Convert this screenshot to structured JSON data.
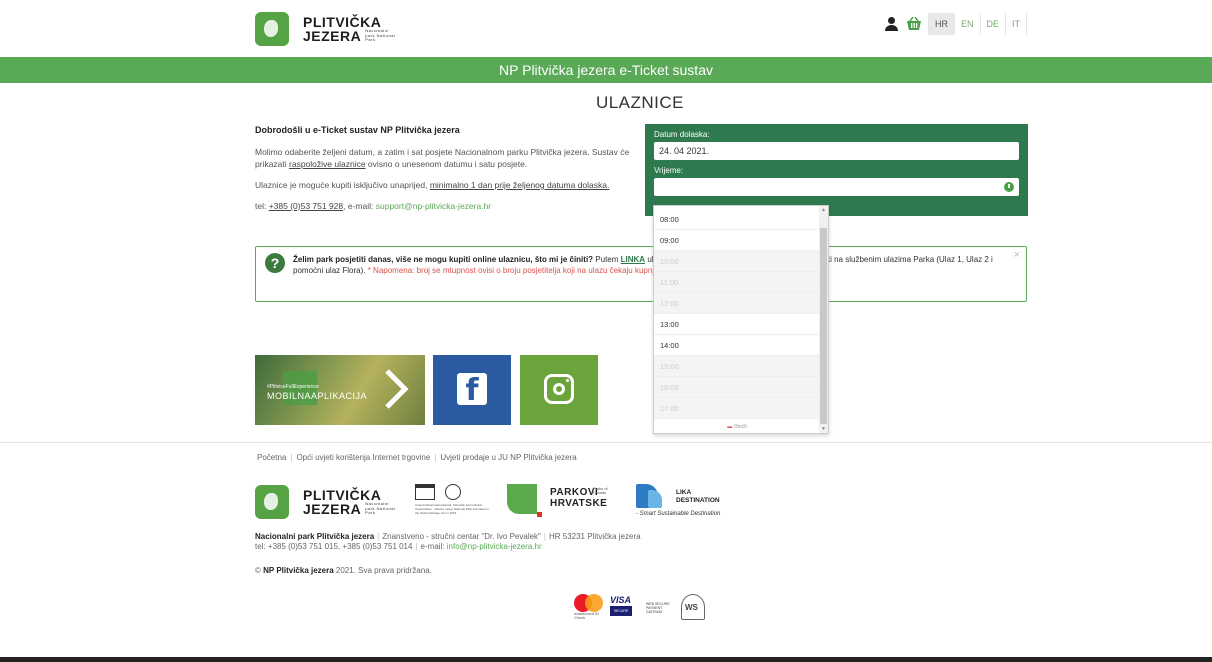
{
  "header": {
    "logo_line1": "PLITVIČKA",
    "logo_line2": "JEZERA",
    "logo_sub": "Nacionalni park National Park",
    "languages": [
      "HR",
      "EN",
      "DE",
      "IT"
    ],
    "active_language": "HR",
    "user_icon": "user-icon",
    "basket_icon": "basket-icon"
  },
  "banner": {
    "title": "NP Plitvička jezera e-Ticket sustav"
  },
  "page": {
    "title": "ULAZNICE"
  },
  "intro": {
    "heading": "Dobrodošli u e-Ticket sustav NP Plitvička jezera",
    "p1_a": "Molimo odaberite željeni datum, a zatim i sat posjete Nacionalnom parku Plitvička jezera. Sustav će prikazati ",
    "p1_link": "raspoložive ulaznice",
    "p1_b": " ovisno o unesenom datumu i satu posjete.",
    "p2_a": "Ulaznice je moguće kupiti isključivo unaprijed, ",
    "p2_u": "minimalno 1 dan prije željenog datuma dolaska.",
    "tel_label": "tel: ",
    "tel": "+385 (0)53 751 928",
    "email_label": ", e-mail: ",
    "email": "support@np-plitvicka-jezera.hr"
  },
  "booking": {
    "date_label": "Datum dolaska:",
    "date_value": "24. 04 2021.",
    "time_label": "Vrijeme:",
    "time_value": ""
  },
  "time_dropdown": {
    "options": [
      {
        "label": "08:00",
        "disabled": false
      },
      {
        "label": "09:00",
        "disabled": false
      },
      {
        "label": "10:00",
        "disabled": true
      },
      {
        "label": "11:00",
        "disabled": true
      },
      {
        "label": "12:00",
        "disabled": true
      },
      {
        "label": "13:00",
        "disabled": false
      },
      {
        "label": "14:00",
        "disabled": false
      },
      {
        "label": "15:00",
        "disabled": true
      },
      {
        "label": "16:00",
        "disabled": true
      },
      {
        "label": "17:00",
        "disabled": true
      }
    ],
    "clear_label": "Obriši"
  },
  "notice": {
    "question": "Želim park posjetiti danas, više ne mogu kupiti online ulaznicu, što mi je činiti?",
    "text_a": " Putem ",
    "link": "LINKA",
    "text_b": " ulaznica po satu i ulazu u park koje je moguće kupiti na službenim ulazima Parka (Ulaz 1, Ulaz 2 i pomoćni ulaz Flora). ",
    "red_a": "* Napomena: broj se m",
    "red_b": "tupnost ovisi o broju posjetitelja koji na ulazu čekaju kupnju na licu mjesta.",
    "close": "×"
  },
  "tiles": {
    "app_tag": "#PlitviceFullExperience",
    "app_name": "MOBILNAAPLIKACIJA",
    "facebook_icon": "facebook-icon",
    "instagram_icon": "instagram-icon"
  },
  "footer": {
    "links": [
      "Početna",
      "Opći uvjeti korištenja Internet trgovine",
      "Uvjeti prodaje u JU NP Plitvička jezera"
    ],
    "unesco_text": "United Nations Educational, Scientific and Cultural Organization · Plitvice Lakes National Park inscribed on the World Heritage List in 1979",
    "parkovi_1": "PARKOVI",
    "parkovi_2": "HRVATSKE",
    "parkovi_sm": "Parks of Croatia",
    "lika_1": "LIKA",
    "lika_2": "DESTINATION",
    "lika_3": "- Smart Sustainable Destination",
    "addr_name": "Nacionalni park Plitvička jezera",
    "addr_center": "Znanstveno - stručni centar \"Dr. Ivo Pevalek\"",
    "addr_city": "HR 53231 Plitvička jezera",
    "addr_tel": "tel: +385 (0)53 751 015, +385 (0)53 751 014",
    "addr_email_label": "e-mail: ",
    "addr_email": "info@np-plitvicka-jezera.hr",
    "copy_a": "© ",
    "copy_b": "NP Plitvička jezera",
    "copy_c": " 2021. Sva prava pridržana.",
    "mc_text": "mastercard ID Check",
    "visa": "VISA",
    "visa_secure": "SECURE",
    "wsp_text": "WEB SECURE PAYMENT GATEWAY",
    "ws": "WS"
  }
}
